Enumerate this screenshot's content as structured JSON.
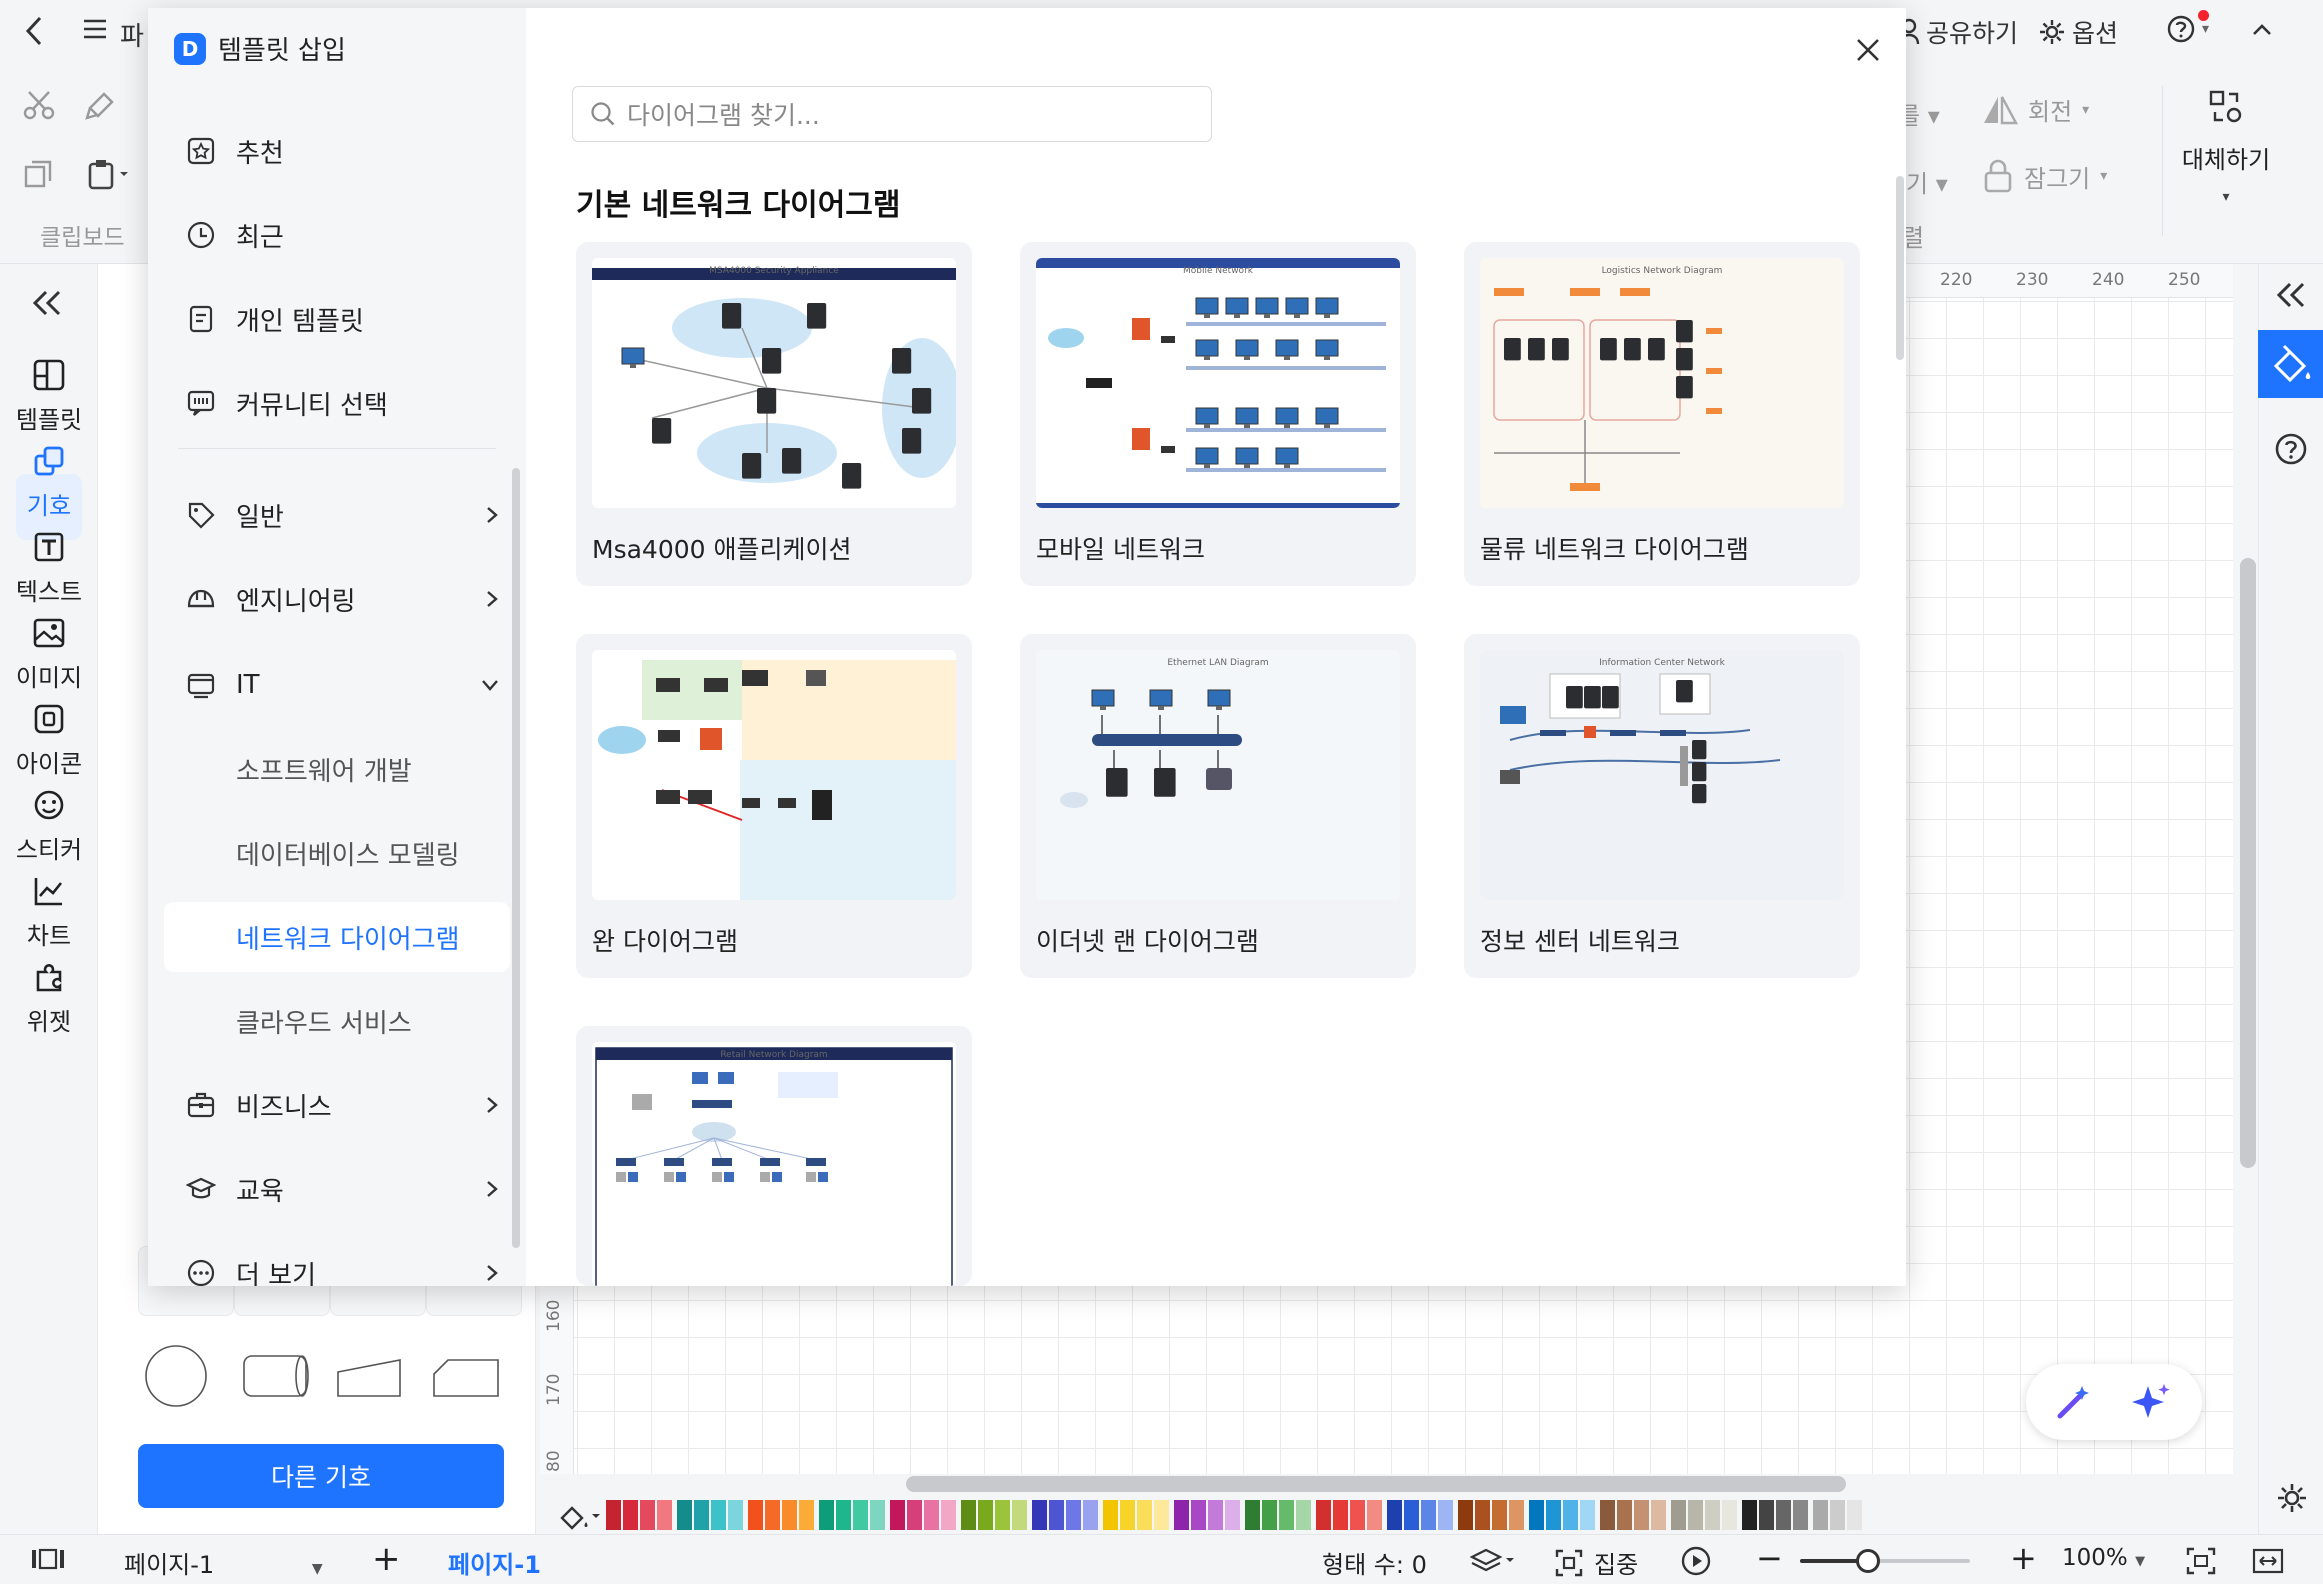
{
  "topbar": {
    "back_icon": "chevron-left-icon",
    "file_label": "파",
    "share_label": "공유하기",
    "options_label": "옵션",
    "help_icon": "question-circle-icon"
  },
  "ribbon": {
    "clipboard_label": "클립보드",
    "rotate_label": "회전",
    "lock_label": "잠그기",
    "replace_label": "대체하기",
    "partial_1": "를",
    "partial_2": "기",
    "partial_3": "렬"
  },
  "rail": {
    "items": [
      {
        "label": "템플릿",
        "icon": "template-icon"
      },
      {
        "label": "기호",
        "icon": "symbol-icon"
      },
      {
        "label": "텍스트",
        "icon": "text-icon"
      },
      {
        "label": "이미지",
        "icon": "image-icon"
      },
      {
        "label": "아이콘",
        "icon": "icon-icon"
      },
      {
        "label": "스티커",
        "icon": "sticker-icon"
      },
      {
        "label": "차트",
        "icon": "chart-icon"
      },
      {
        "label": "위젯",
        "icon": "widget-icon"
      }
    ]
  },
  "symbols": {
    "other_button": "다른 기호"
  },
  "ruler": {
    "top": [
      "220",
      "230",
      "240",
      "250"
    ],
    "left": [
      "160",
      "170",
      "80"
    ]
  },
  "modal": {
    "title": "템플릿 삽입",
    "search_placeholder": "다이어그램 찾기...",
    "section_title": "기본 네트워크 다이어그램",
    "nav_top": [
      {
        "label": "추천",
        "icon": "star-icon"
      },
      {
        "label": "최근",
        "icon": "clock-icon"
      },
      {
        "label": "개인 템플릿",
        "icon": "document-icon"
      },
      {
        "label": "커뮤니티 선택",
        "icon": "community-icon"
      }
    ],
    "nav_categories": [
      {
        "label": "일반",
        "icon": "tag-icon"
      },
      {
        "label": "엔지니어링",
        "icon": "helmet-icon"
      },
      {
        "label": "IT",
        "icon": "monitor-icon"
      }
    ],
    "nav_sub": [
      "소프트웨어 개발",
      "데이터베이스 모델링",
      "네트워크 다이어그램",
      "클라우드 서비스"
    ],
    "nav_bottom": [
      {
        "label": "비즈니스",
        "icon": "briefcase-icon"
      },
      {
        "label": "교육",
        "icon": "graduation-cap-icon"
      },
      {
        "label": "더 보기",
        "icon": "more-icon"
      }
    ],
    "cards": [
      {
        "caption": "Msa4000 애플리케이션",
        "thumb_title": "MSA4000 Security Appliance"
      },
      {
        "caption": "모바일 네트워크",
        "thumb_title": "Mobile Network"
      },
      {
        "caption": "물류 네트워크 다이어그램",
        "thumb_title": "Logistics Network Diagram"
      },
      {
        "caption": "완 다이어그램",
        "thumb_title": ""
      },
      {
        "caption": "이더넷 랜 다이어그램",
        "thumb_title": "Ethernet LAN Diagram"
      },
      {
        "caption": "정보 센터 네트워크",
        "thumb_title": "Information Center Network"
      },
      {
        "caption": "",
        "thumb_title": "Retail Network Diagram"
      }
    ]
  },
  "status": {
    "page_label": "페이지-1",
    "active_page_tab": "페이지-1",
    "shape_count": "형태 수: 0",
    "focus_label": "집중",
    "zoom": "100%",
    "zoom_level": 0.4
  },
  "colors": {
    "accent": "#1f74ff",
    "palette": [
      "#c4242f",
      "#d6293b",
      "#e44a5e",
      "#f2787f",
      "#158c8c",
      "#20a3a8",
      "#3cc2c8",
      "#7ad6dc",
      "#f0511d",
      "#f66a28",
      "#f98b2b",
      "#fbab38",
      "#0e9d79",
      "#1fb58d",
      "#41c9a2",
      "#7ed6c0",
      "#c2185b",
      "#d63f7a",
      "#e872a1",
      "#f3a7c6",
      "#5f8c14",
      "#7aa91e",
      "#9cc43a",
      "#c2da7c",
      "#3437b8",
      "#4e55d3",
      "#6d77e6",
      "#9aa2f0",
      "#f2c500",
      "#f7d42a",
      "#fadd5b",
      "#fce99b",
      "#8e24aa",
      "#a848c4",
      "#c37ad8",
      "#dcaeea",
      "#2e7d32",
      "#43a047",
      "#66bb6a",
      "#a5d6a7",
      "#d32f2f",
      "#e53935",
      "#ef5350",
      "#f28b82",
      "#1e40af",
      "#2b5dd6",
      "#5b86e8",
      "#9db5f2",
      "#8d3a0f",
      "#a9521f",
      "#c46d32",
      "#dc9563",
      "#0277bd",
      "#1e95d4",
      "#4fb3e8",
      "#9fd7f5",
      "#8a5a3c",
      "#a8724f",
      "#c49173",
      "#ddb9a1",
      "#9e9d8f",
      "#b7b6a9",
      "#cfcec3",
      "#e8e7df",
      "#222222",
      "#444444",
      "#666666",
      "#888888",
      "#aaaaaa",
      "#cccccc",
      "#e5e5e5"
    ]
  }
}
